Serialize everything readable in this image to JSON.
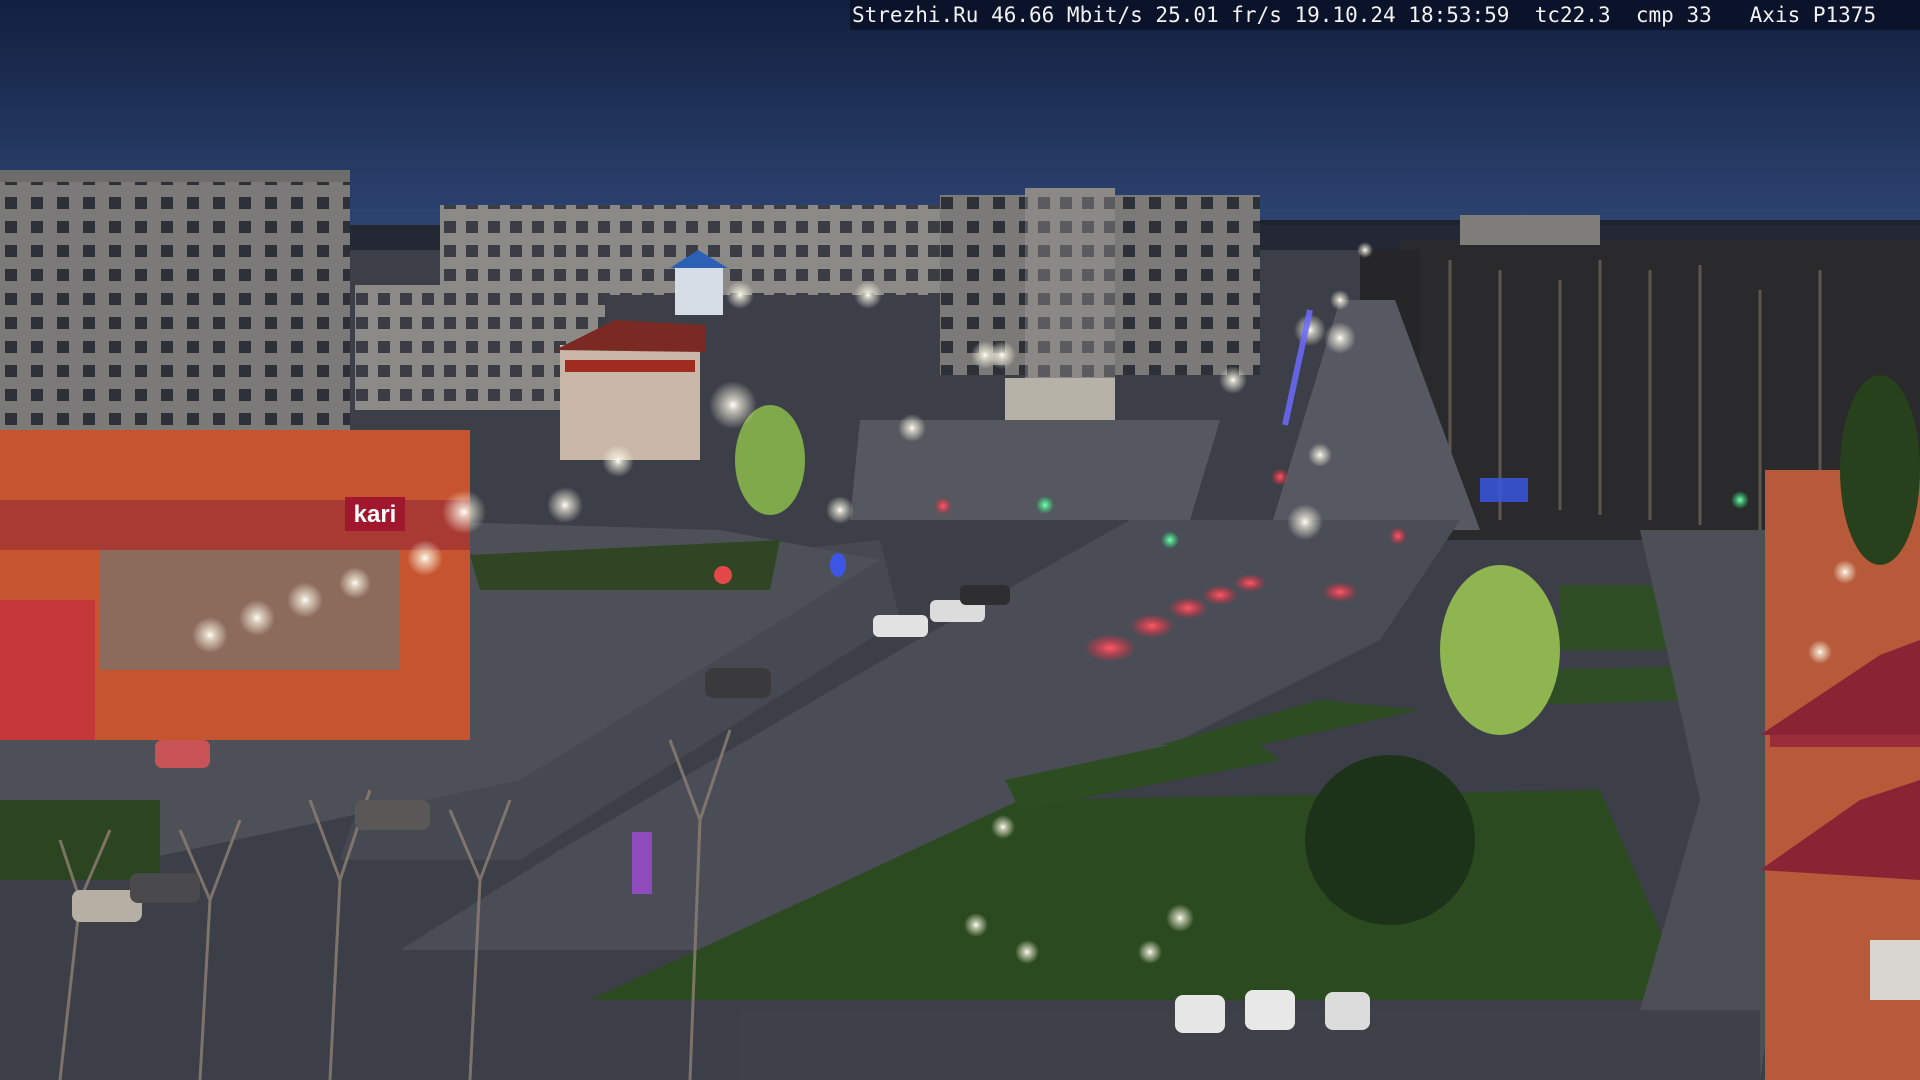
{
  "overlay": {
    "text": "Strezhi.Ru 46.66 Mbit/s 25.01 fr/s 19.10.24 18:53:59  tc22.3  cmp 33   Axis P1375"
  },
  "signs": {
    "store_logo": "kari"
  },
  "colors": {
    "sky_top": "#14213f",
    "sky_bottom": "#2e4270",
    "road": "#454852",
    "grass": "#2f4a24",
    "lamp": "#ffffff",
    "brick": "#b85a3a"
  }
}
